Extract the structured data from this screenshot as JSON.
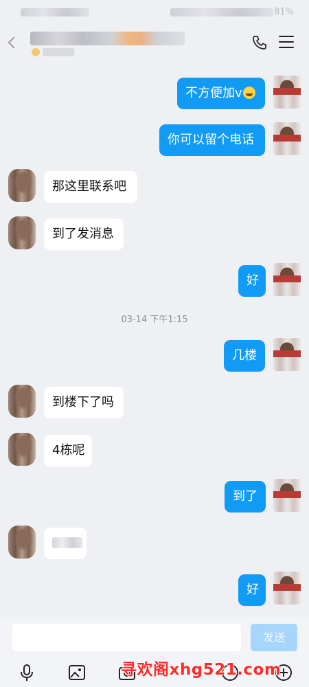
{
  "status_bar": {
    "battery": "81%"
  },
  "header": {
    "icons": [
      "back-icon",
      "phone-icon",
      "menu-icon"
    ]
  },
  "messages": [
    {
      "side": "out",
      "text": "不方便加v",
      "emoji": "laughing-tears-emoji"
    },
    {
      "side": "out",
      "text": "你可以留个电话"
    },
    {
      "side": "in",
      "text": "那这里联系吧"
    },
    {
      "side": "in",
      "text": "到了发消息"
    },
    {
      "side": "out",
      "text": "好"
    },
    {
      "side": "out",
      "text": "几楼"
    },
    {
      "side": "in",
      "text": "到楼下了吗"
    },
    {
      "side": "in",
      "text": "4栋呢"
    },
    {
      "side": "out",
      "text": "到了"
    },
    {
      "side": "in",
      "text": "",
      "redacted": true
    },
    {
      "side": "out",
      "text": "好"
    }
  ],
  "time_separator": "03-14 下午1:15",
  "input": {
    "value": "",
    "placeholder": ""
  },
  "send_label": "发送",
  "toolbar": {
    "icons": [
      "microphone-icon",
      "image-icon",
      "camera-icon",
      "emoji-icon",
      "plus-icon"
    ]
  },
  "watermark": "寻欢阁xhg521.com",
  "colors": {
    "outgoing_bubble": "#129bf5",
    "incoming_bubble": "#ffffff",
    "background": "#eff0f4",
    "watermark": "#ff2a2a"
  }
}
